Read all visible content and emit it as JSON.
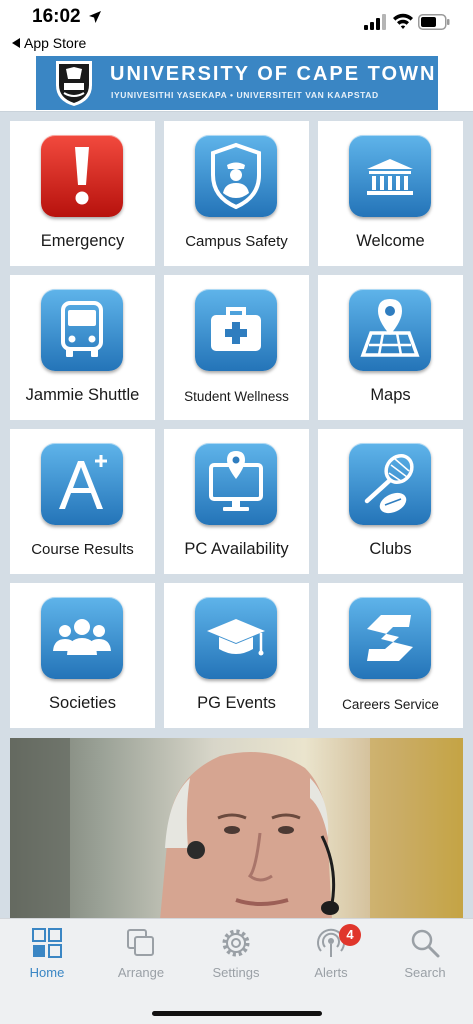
{
  "status_bar": {
    "time": "16:02",
    "icons": [
      "location-arrow-icon",
      "cellular-signal-icon",
      "wifi-icon",
      "battery-icon"
    ]
  },
  "back_link": {
    "label": "App Store"
  },
  "header": {
    "title": "UNIVERSITY OF CAPE TOWN",
    "subtitle": "IYUNIVESITHI YASEKAPA • UNIVERSITEIT VAN KAAPSTAD"
  },
  "tiles": [
    {
      "label": "Emergency",
      "icon": "exclamation-icon",
      "color": "#d3231b"
    },
    {
      "label": "Campus Safety",
      "icon": "shield-officer-icon",
      "color": "#3a86c4"
    },
    {
      "label": "Welcome",
      "icon": "building-icon",
      "color": "#3a86c4"
    },
    {
      "label": "Jammie Shuttle",
      "icon": "bus-icon",
      "color": "#3a86c4"
    },
    {
      "label": "Student Wellness",
      "icon": "medical-kit-icon",
      "color": "#3a86c4"
    },
    {
      "label": "Maps",
      "icon": "map-pin-icon",
      "color": "#3a86c4"
    },
    {
      "label": "Course Results",
      "icon": "a-plus-grade-icon",
      "color": "#3a86c4"
    },
    {
      "label": "PC Availability",
      "icon": "monitor-pin-icon",
      "color": "#3a86c4"
    },
    {
      "label": "Clubs",
      "icon": "racket-ball-icon",
      "color": "#3a86c4"
    },
    {
      "label": "Societies",
      "icon": "people-group-icon",
      "color": "#3a86c4"
    },
    {
      "label": "PG Events",
      "icon": "graduation-cap-icon",
      "color": "#3a86c4"
    },
    {
      "label": "Careers Service",
      "icon": "careers-s-logo-icon",
      "color": "#3a86c4"
    }
  ],
  "tabbar": {
    "tabs": [
      {
        "label": "Home",
        "icon": "grid-icon",
        "active": true
      },
      {
        "label": "Arrange",
        "icon": "stacked-squares-icon",
        "active": false
      },
      {
        "label": "Settings",
        "icon": "gear-icon",
        "active": false
      },
      {
        "label": "Alerts",
        "icon": "broadcast-icon",
        "active": false,
        "badge": "4"
      },
      {
        "label": "Search",
        "icon": "magnifier-icon",
        "active": false
      }
    ],
    "active_color": "#3a86c4",
    "inactive_color": "#9aa0a6"
  }
}
